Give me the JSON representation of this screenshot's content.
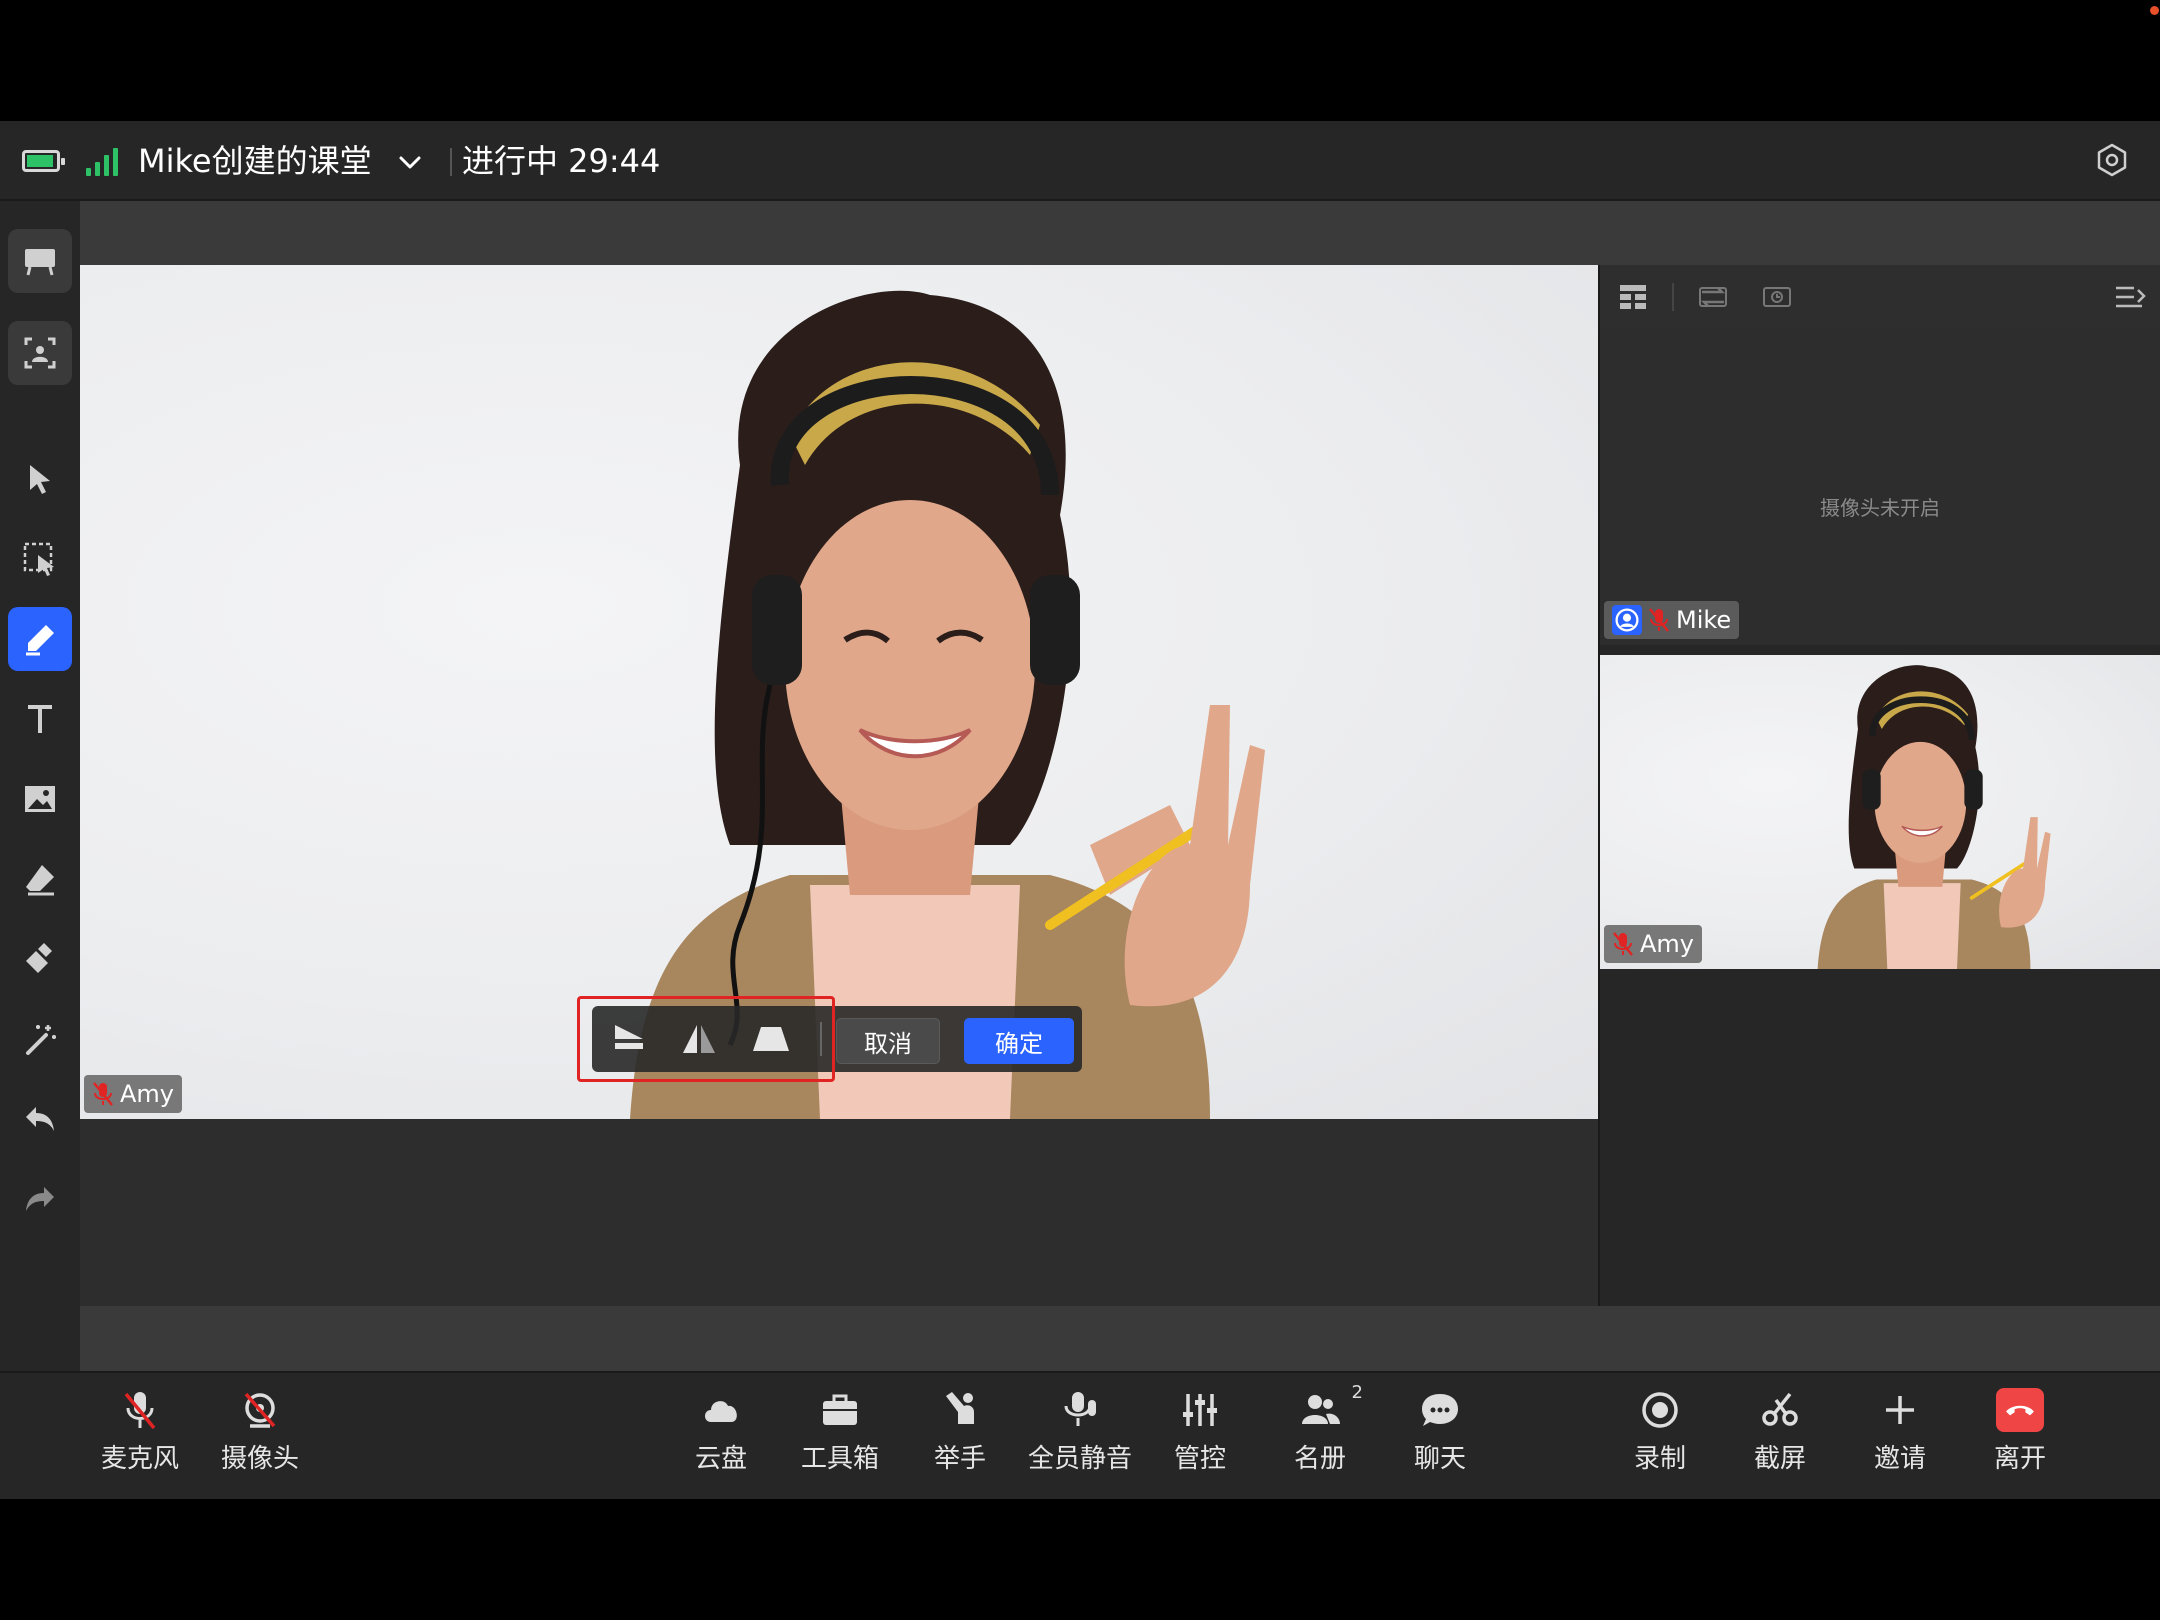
{
  "header": {
    "class_title": "Mike创建的课堂",
    "status": "进行中 29:44"
  },
  "left_toolbar": {
    "items": [
      "whiteboard",
      "gallery-view",
      "select",
      "area-select",
      "pen",
      "text",
      "image",
      "eraser",
      "clear",
      "laser",
      "undo",
      "redo"
    ]
  },
  "main_video": {
    "participant": "Amy"
  },
  "crop_toolbar": {
    "cancel_label": "取消",
    "confirm_label": "确定"
  },
  "right_panel": {
    "camera_off_text": "摄像头未开启",
    "tiles": [
      {
        "name": "Mike"
      },
      {
        "name": "Amy"
      }
    ]
  },
  "bottom_bar": {
    "microphone": "麦克风",
    "camera": "摄像头",
    "cloud": "云盘",
    "toolbox": "工具箱",
    "raise_hand": "举手",
    "mute_all": "全员静音",
    "control": "管控",
    "roster": "名册",
    "roster_count": "2",
    "chat": "聊天",
    "record": "录制",
    "screenshot": "截屏",
    "invite": "邀请",
    "leave": "离开"
  },
  "colors": {
    "accent": "#2b63ff",
    "danger": "#f04545",
    "signal": "#2ec266",
    "mute_red": "#e02424"
  }
}
